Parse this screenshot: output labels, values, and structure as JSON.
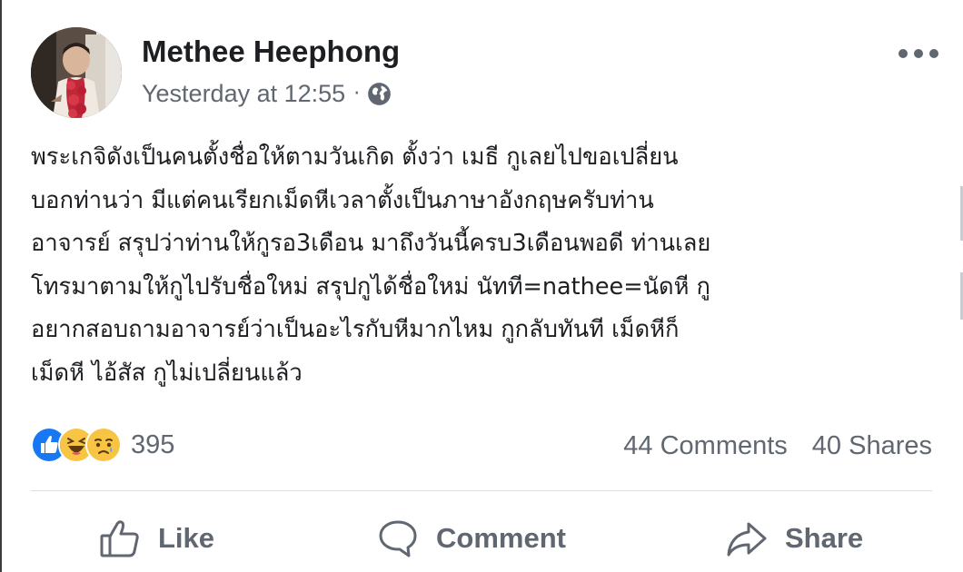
{
  "post": {
    "author": "Methee Heephong",
    "timestamp": "Yesterday at 12:55",
    "separator": "·",
    "privacy_icon": "globe-icon",
    "menu_icon": "more-horizontal-icon",
    "text_lines": [
      "พระเกจิดังเป็นคนตั้งชื่อให้ตามวันเกิด ตั้งว่า เมธี กูเลยไปขอเปลี่ยน",
      "บอกท่านว่า มีแต่คนเรียกเม็ดหีเวลาตั้งเป็นภาษาอังกฤษครับท่าน",
      "อาจารย์ สรุปว่าท่านให้กูรอ3เดือน มาถึงวันนี้ครบ3เดือนพอดี ท่านเลย",
      "โทรมาตามให้กูไปรับชื่อใหม่ สรุปกูได้ชื่อใหม่ นัทที=nathee=นัดหี กู",
      "อยากสอบถามอาจารย์ว่าเป็นอะไรกับหีมากไหม กูกลับทันที เม็ดหีก็",
      "เม็ดหี ไอ้สัส กูไม่เปลี่ยนแล้ว"
    ]
  },
  "reactions": {
    "icons": [
      "like-reaction-icon",
      "haha-reaction-icon",
      "sad-reaction-icon"
    ],
    "count": "395"
  },
  "stats": {
    "comments": "44 Comments",
    "shares": "40 Shares"
  },
  "actions": {
    "like": "Like",
    "comment": "Comment",
    "share": "Share"
  },
  "colors": {
    "text": "#1c1e21",
    "secondary": "#606770",
    "like_blue": "#1877f2",
    "reaction_yellow": "#f7c443",
    "divider": "#dadde1"
  }
}
